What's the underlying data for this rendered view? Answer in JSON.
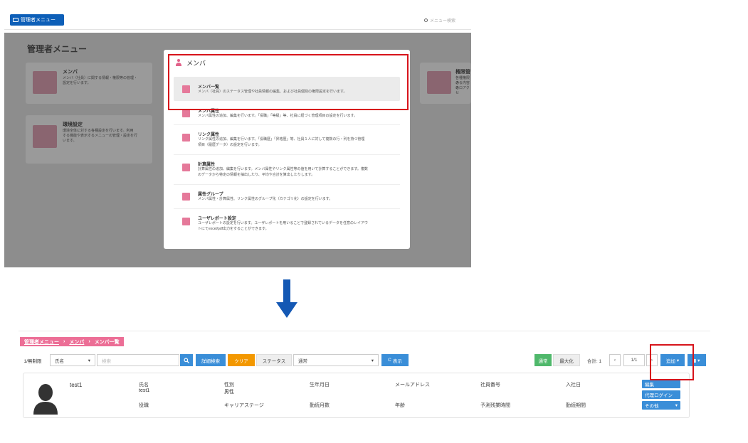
{
  "top": {
    "admin_button": "管理者メニュー",
    "search_placeholder": "メニュー検索",
    "overlay_title": "管理者メニュー",
    "bg_cards": [
      {
        "title": "メンバ",
        "desc1": "メンバ（社員）に関する情報・権限等の管理・",
        "desc2": "設定を行います。"
      },
      {
        "title": "環境設定",
        "desc1": "環境全体に対する各種設定を行います。利用",
        "desc2": "する機能や表示するメニューの管理・設定を行",
        "desc3": "います。"
      },
      {
        "title": "権限管",
        "desc1": "各種権限の",
        "desc2": "きる内容の",
        "desc3": "をロアクセ"
      }
    ],
    "modal": {
      "title": "メンバ",
      "items": [
        {
          "title": "メンバ一覧",
          "desc": "メンバ（社員）のステータス管理や社員情報の編集、および社員個別の権限設定を行います。",
          "desc2": ""
        },
        {
          "title": "メンバ属性",
          "desc": "メンバ属性の追加、編集を行います。「役職」「等級」等、社員に紐づく管理項目の設定を行います。",
          "desc2": ""
        },
        {
          "title": "リンク属性",
          "desc": "リンク属性の追加、編集を行います。「役職歴」「昇格歴」等、社員１人に対して複数の行・列を持つ管理",
          "desc2": "項目（履歴データ）の設定を行います。"
        },
        {
          "title": "計算属性",
          "desc": "計算属性の追加、編集を行います。メンバ属性やリンク属性等の値を用いて計算することができます。複数",
          "desc2": "のデータから特定の情報を抽出したり、平均や合計を算出したりします。"
        },
        {
          "title": "属性グループ",
          "desc": "メンバ属性・計算属性、リンク属性のグループ化（カテゴリ化）の設定を行います。",
          "desc2": ""
        },
        {
          "title": "ユーザレポート設定",
          "desc": "ユーザレポートの設定を行います。ユーザレポートを用いることで登録されているデータを任意のレイアウ",
          "desc2": "トにてexcel/pdf出力をすることができます。"
        }
      ]
    }
  },
  "bottom": {
    "breadcrumb": {
      "root": "管理者メニュー",
      "sep": "›",
      "mid": "メンバ",
      "current": "メンバ一覧"
    },
    "toolbar": {
      "limit": "1/無制限",
      "field_select": "氏名",
      "search_placeholder": "検索",
      "detail_search": "詳細検索",
      "clear": "クリア",
      "status_label": "ステータス",
      "status_value": "通常",
      "show": "表示",
      "normal": "通常",
      "maximize": "最大化",
      "total": "合計: 1",
      "page": "1/1",
      "add": "追加"
    },
    "member": {
      "name": "test1",
      "fields": [
        {
          "label": "氏名",
          "value": "test1"
        },
        {
          "label": "性別",
          "value": "男性"
        },
        {
          "label": "生年月日",
          "value": ""
        },
        {
          "label": "メールアドレス",
          "value": ""
        },
        {
          "label": "社員番号",
          "value": ""
        },
        {
          "label": "入社日",
          "value": ""
        }
      ],
      "fields2": [
        "役職",
        "キャリアステージ",
        "勤続月数",
        "年齢",
        "予測残業時間",
        "勤続期間"
      ],
      "buttons": {
        "edit": "編集",
        "proxy": "代理ログイン",
        "other": "その他"
      }
    }
  },
  "colors": {
    "brand_blue": "#0d5fb8",
    "pink": "#ec6e96",
    "highlight_red": "#d7141b",
    "arrow_blue": "#1458b4"
  }
}
